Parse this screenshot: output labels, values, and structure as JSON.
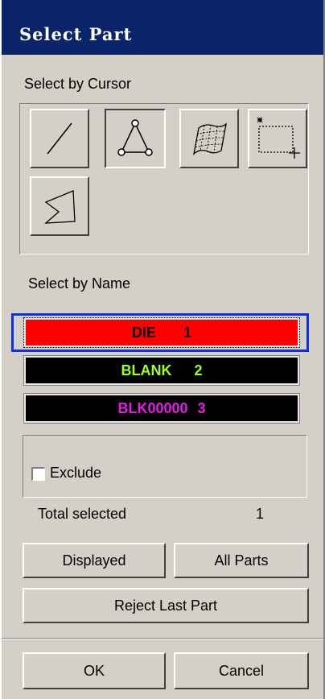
{
  "window": {
    "title": "Select Part"
  },
  "cursor_section": {
    "label": "Select by Cursor",
    "tools": [
      {
        "name": "line",
        "icon": "line-select-icon"
      },
      {
        "name": "triangle",
        "icon": "triangle-select-icon",
        "active": true
      },
      {
        "name": "surface",
        "icon": "surface-mesh-icon"
      },
      {
        "name": "box",
        "icon": "box-select-icon"
      },
      {
        "name": "polygon",
        "icon": "polygon-select-icon"
      }
    ]
  },
  "name_section": {
    "label": "Select by Name",
    "parts": [
      {
        "name": "DIE",
        "id": "1",
        "bg": "#ff0000",
        "fg": "#000000",
        "selected": true
      },
      {
        "name": "BLANK",
        "id": "2",
        "bg": "#000000",
        "fg": "#a0ff20"
      },
      {
        "name": "BLK00000",
        "id": "3",
        "bg": "#000000",
        "fg": "#e020e0"
      }
    ]
  },
  "exclude": {
    "label": "Exclude",
    "checked": false
  },
  "total": {
    "label": "Total selected",
    "value": "1"
  },
  "buttons": {
    "displayed": "Displayed",
    "all_parts": "All Parts",
    "reject_last": "Reject Last Part",
    "ok": "OK",
    "cancel": "Cancel"
  },
  "colors": {
    "titlebar": "#0a246a",
    "dialog_bg": "#d4d0c8",
    "selection_highlight": "#1030e0"
  }
}
